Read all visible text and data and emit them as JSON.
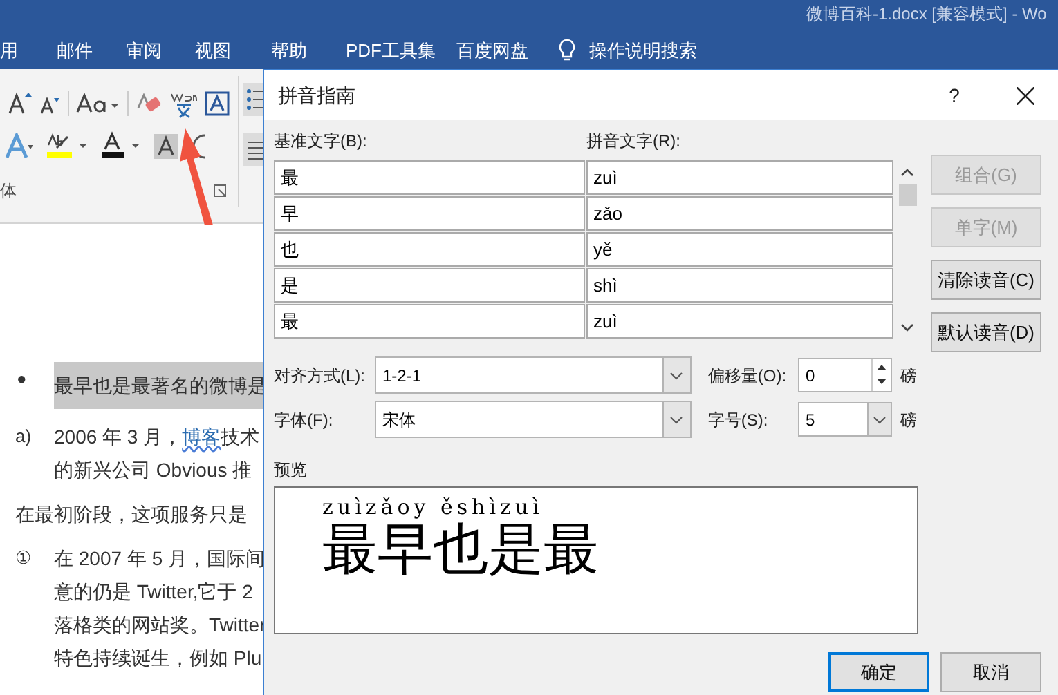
{
  "title_bar": {
    "title": "微博百科-1.docx [兼容模式]  -  Wo"
  },
  "menu_tabs": [
    {
      "label": "用",
      "kind": "tab"
    },
    {
      "label": "邮件",
      "kind": "tab"
    },
    {
      "label": "审阅",
      "kind": "tab"
    },
    {
      "label": "视图",
      "kind": "tab"
    },
    {
      "label": "帮助",
      "kind": "tab"
    },
    {
      "label": "PDF工具集",
      "kind": "tab"
    },
    {
      "label": "百度网盘",
      "kind": "tab"
    },
    {
      "label": "操作说明搜索",
      "kind": "search"
    }
  ],
  "ribbon": {
    "group_label": "体"
  },
  "document": {
    "items": [
      {
        "kind": "bullet",
        "marker": "●",
        "highlighted": true,
        "lines": [
          [
            {
              "text": "最早也是最著名的微博是",
              "link": false
            }
          ]
        ]
      },
      {
        "kind": "list",
        "marker": "a)",
        "highlighted": false,
        "lines": [
          [
            {
              "text": "2006 年 3 月，",
              "link": false
            },
            {
              "text": "博客",
              "link": true
            },
            {
              "text": "技术",
              "link": false
            }
          ],
          [
            {
              "text": "的新兴公司 Obvious 推",
              "link": false
            }
          ]
        ]
      },
      {
        "kind": "paragraph",
        "highlighted": false,
        "lines": [
          [
            {
              "text": "在最初阶段，这项服务只是",
              "link": false
            }
          ]
        ]
      },
      {
        "kind": "list",
        "marker": "①",
        "highlighted": false,
        "lines": [
          [
            {
              "text": "在 2007 年 5 月，国际间",
              "link": false
            }
          ],
          [
            {
              "text": "意的仍是 Twitter,它于 2",
              "link": false
            }
          ],
          [
            {
              "text": "落格类的网站奖。Twitter",
              "link": false
            }
          ],
          [
            {
              "text": "特色持续诞生，例如 Plu",
              "link": false
            }
          ]
        ]
      }
    ]
  },
  "dialog": {
    "title": "拼音指南",
    "help": "?",
    "base_label": "基准文字(B):",
    "ruby_label": "拼音文字(R):",
    "rows": [
      {
        "base": "最",
        "ruby": "zuì"
      },
      {
        "base": "早",
        "ruby": "zǎo"
      },
      {
        "base": "也",
        "ruby": "yě"
      },
      {
        "base": "是",
        "ruby": "shì"
      },
      {
        "base": "最",
        "ruby": "zuì"
      }
    ],
    "buttons": [
      {
        "label": "组合(G)",
        "disabled": true
      },
      {
        "label": "单字(M)",
        "disabled": true
      },
      {
        "label": "清除读音(C)",
        "disabled": false
      },
      {
        "label": "默认读音(D)",
        "disabled": false
      }
    ],
    "alignment": {
      "label": "对齐方式(L):",
      "value": "1-2-1"
    },
    "offset": {
      "label": "偏移量(O):",
      "value": "0",
      "unit": "磅"
    },
    "font": {
      "label": "字体(F):",
      "value": "宋体"
    },
    "size": {
      "label": "字号(S):",
      "value": "5",
      "unit": "磅"
    },
    "preview": {
      "label": "预览",
      "ruby": "zuìzǎoy ěshìzuì",
      "base": "最早也是最"
    },
    "footer_buttons": [
      {
        "label": "确定",
        "focused": true
      },
      {
        "label": "取消",
        "focused": false
      }
    ]
  }
}
